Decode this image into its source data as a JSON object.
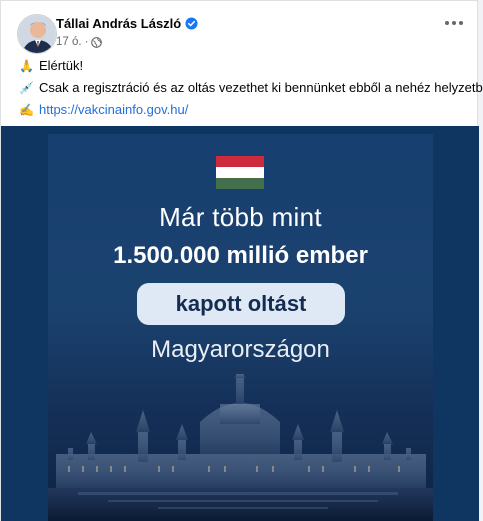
{
  "post": {
    "author": "Tállai András László",
    "timestamp": "17 ó.",
    "lines": [
      {
        "emoji": "🙏",
        "text": "Elértük!"
      },
      {
        "emoji": "💉",
        "text": "Csak a regisztráció és az oltás vezethet ki bennünket ebből a nehéz helyzetből."
      },
      {
        "emoji": "✍",
        "text": "https://vakcinainfo.gov.hu/"
      }
    ]
  },
  "poster": {
    "line1": "Már több mint",
    "line2": "1.500.000 millió ember",
    "line3": "kapott oltást",
    "line4": "Magyarországon"
  },
  "icons": {
    "verified": "verified-badge-icon",
    "privacy": "globe-icon",
    "more": "more-options-icon"
  },
  "colors": {
    "link": "#216fdb",
    "verified": "#1877f2",
    "poster_bg": "#173f6f",
    "flag": [
      "#cd2a3e",
      "#ffffff",
      "#436f4d"
    ]
  }
}
